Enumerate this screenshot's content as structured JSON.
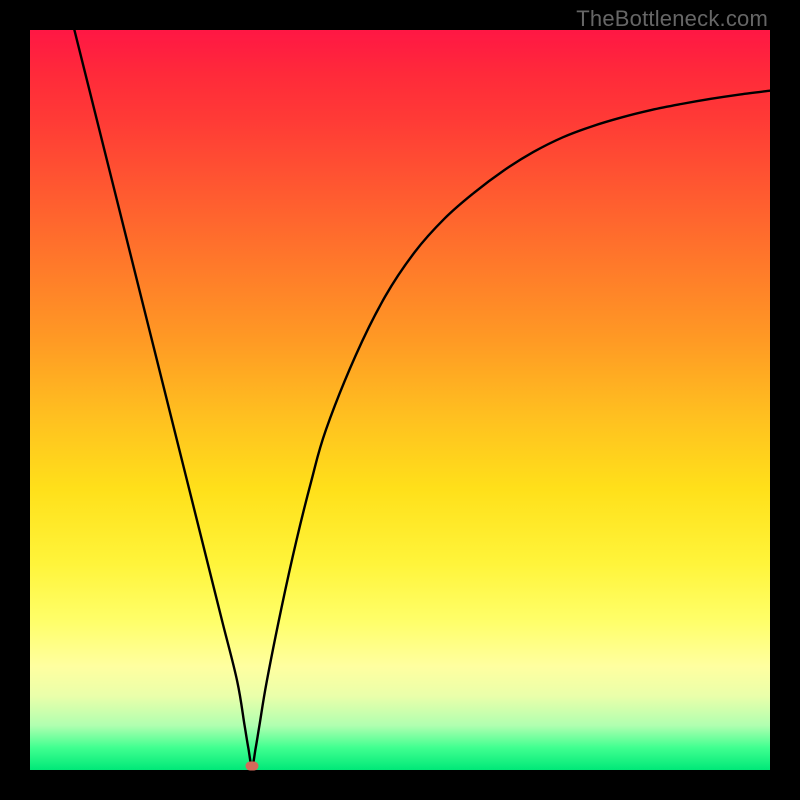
{
  "watermark": "TheBottleneck.com",
  "chart_data": {
    "type": "line",
    "title": "",
    "xlabel": "",
    "ylabel": "",
    "xlim": [
      0,
      100
    ],
    "ylim": [
      0,
      100
    ],
    "x": [
      6,
      8,
      10,
      12,
      14,
      16,
      18,
      20,
      22,
      24,
      26,
      28,
      29,
      29.5,
      30,
      30.5,
      31,
      32,
      34,
      36,
      38,
      40,
      44,
      48,
      52,
      56,
      60,
      64,
      68,
      72,
      76,
      80,
      84,
      88,
      92,
      96,
      100
    ],
    "values": [
      100,
      92,
      84,
      76,
      68,
      60,
      52,
      44,
      36,
      28,
      20,
      12,
      6,
      3,
      0.5,
      3,
      6,
      12,
      22,
      31,
      39,
      46,
      56,
      64,
      70,
      74.5,
      78,
      81,
      83.5,
      85.5,
      87,
      88.2,
      89.2,
      90,
      90.7,
      91.3,
      91.8
    ],
    "minimum_point": {
      "x": 30,
      "y": 0.5,
      "color": "#d66a5a"
    },
    "gradient_stops": [
      {
        "pos": 0.0,
        "color": "#ff1744"
      },
      {
        "pos": 0.5,
        "color": "#ffd020"
      },
      {
        "pos": 0.82,
        "color": "#ffff80"
      },
      {
        "pos": 1.0,
        "color": "#00e878"
      }
    ]
  }
}
